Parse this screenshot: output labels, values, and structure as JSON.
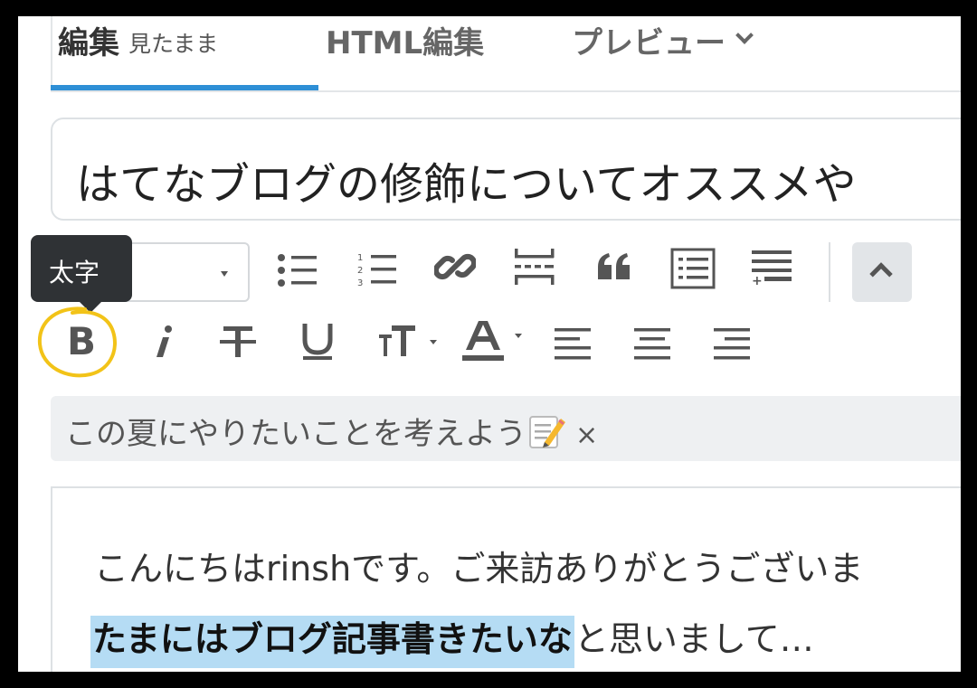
{
  "tabs": {
    "edit_label": "編集",
    "edit_sub": "見たまま",
    "html_label": "HTML編集",
    "preview_label": "プレビュー"
  },
  "title": {
    "value": "はてなブログの修飾についてオススメや"
  },
  "tooltip": {
    "text": "太字"
  },
  "toolbar": {
    "bold_label": "B",
    "icons": [
      "bullet-list-icon",
      "numbered-list-icon",
      "link-icon",
      "read-more-icon",
      "blockquote-icon",
      "table-of-contents-icon",
      "footnote-icon",
      "chevron-up-icon",
      "italic-icon",
      "strikethrough-icon",
      "underline-icon",
      "font-size-icon",
      "text-color-icon",
      "align-left-icon",
      "align-center-icon",
      "align-right-icon"
    ]
  },
  "theme": {
    "text": "この夏にやりたいことを考えよう",
    "close": "×"
  },
  "editor": {
    "line1": "こんにちはrinshです。ご来訪ありがとうございま",
    "line2_highlight": "たまにはブログ記事書きたいな",
    "line2_rest": "と思いまして…"
  },
  "colors": {
    "accent": "#2e8fd6",
    "highlight": "#b5dcf4",
    "annotation": "#f2c318",
    "tooltip_bg": "#2f3235"
  }
}
